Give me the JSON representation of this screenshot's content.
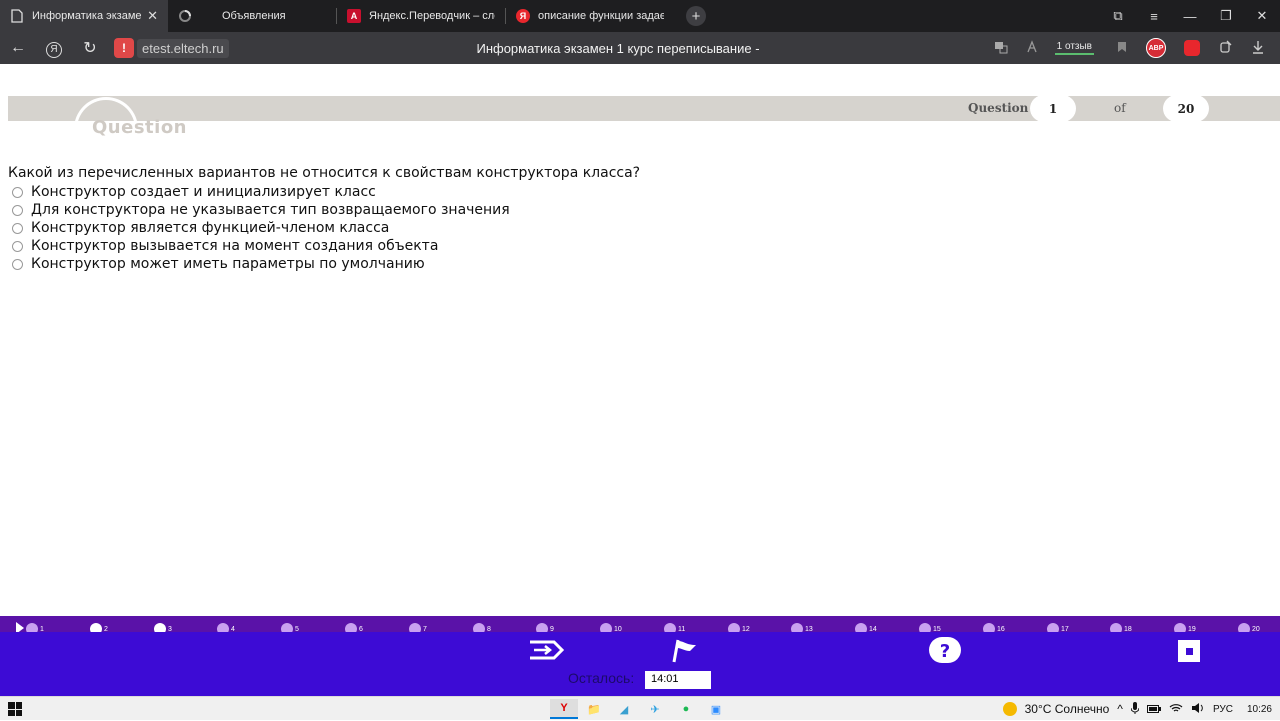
{
  "browser": {
    "tabs": [
      {
        "title": "Информатика экзамен",
        "active": true,
        "icon": "document-icon"
      },
      {
        "title": "Объявления",
        "active": false,
        "icon": "spinner-icon"
      },
      {
        "title": "Яндекс.Переводчик – сло",
        "active": false,
        "icon": "translate-icon"
      },
      {
        "title": "описание функции задае",
        "active": false,
        "icon": "yandex-icon"
      }
    ],
    "tab_close": "✕",
    "newtab": "+",
    "window": {
      "collections": "⧉",
      "menu": "≡",
      "minimize": "—",
      "maximize": "❐",
      "close": "✕"
    },
    "address": {
      "back": "←",
      "yandex": "Я",
      "reload": "↻",
      "warning": "!",
      "url": "etest.eltech.ru",
      "page_title": "Информатика экзамен 1 курс переписывание -",
      "reviews": "1 отзыв",
      "abp": "ABP"
    }
  },
  "quiz": {
    "logo_text": "Question",
    "question_label": "Question",
    "current": "1",
    "of_label": "of",
    "total": "20",
    "question_text": "Какой из перечисленных вариантов не относится к свойствам конструктора класса?",
    "answers": [
      "Конструктор создает и инициализирует класс",
      "Для конструктора не указывается тип возвращаемого значения",
      "Конструктор является функцией-членом класса",
      "Конструктор вызывается на момент создания объекта",
      "Конструктор может иметь параметры по умолчанию"
    ],
    "nav_numbers": [
      "1",
      "2",
      "3",
      "4",
      "5",
      "6",
      "7",
      "8",
      "9",
      "10",
      "11",
      "12",
      "13",
      "14",
      "15",
      "16",
      "17",
      "18",
      "19",
      "20"
    ],
    "remaining_label": "Осталось:",
    "remaining_value": "14:01",
    "colors": {
      "track": "#5a12a8",
      "bar": "#3d0bd5",
      "dot": "#c9a0f0"
    }
  },
  "taskbar": {
    "weather": "30°C  Солнечно",
    "lang": "РУС",
    "time": "10:26",
    "apps": [
      "Y",
      "📁",
      "◢",
      "✈",
      "●",
      "▣"
    ]
  }
}
